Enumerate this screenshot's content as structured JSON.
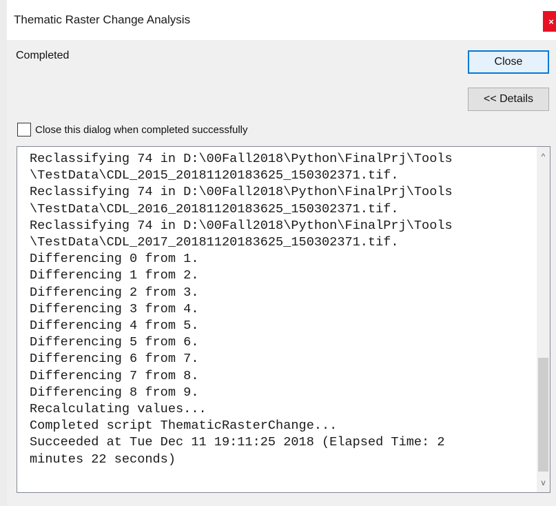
{
  "window": {
    "title": "Thematic Raster Change Analysis",
    "close_glyph": "×"
  },
  "status": {
    "text": "Completed"
  },
  "buttons": {
    "close_label": "Close",
    "details_label": "<< Details"
  },
  "option": {
    "close_when_done_label": "Close this dialog when completed successfully",
    "checked": false
  },
  "output": {
    "lines": [
      "Reclassifying 74 in D:\\00Fall2018\\Python\\FinalPrj\\Tools",
      "\\TestData\\CDL_2015_20181120183625_150302371.tif.",
      "Reclassifying 74 in D:\\00Fall2018\\Python\\FinalPrj\\Tools",
      "\\TestData\\CDL_2016_20181120183625_150302371.tif.",
      "Reclassifying 74 in D:\\00Fall2018\\Python\\FinalPrj\\Tools",
      "\\TestData\\CDL_2017_20181120183625_150302371.tif.",
      "Differencing 0 from 1.",
      "Differencing 1 from 2.",
      "Differencing 2 from 3.",
      "Differencing 3 from 4.",
      "Differencing 4 from 5.",
      "Differencing 5 from 6.",
      "Differencing 6 from 7.",
      "Differencing 7 from 8.",
      "Differencing 8 from 9.",
      "Recalculating values...",
      "Completed script ThematicRasterChange...",
      "Succeeded at Tue Dec 11 19:11:25 2018 (Elapsed Time: 2",
      "minutes 22 seconds)"
    ]
  },
  "scrollbar": {
    "up_glyph": "^",
    "down_glyph": "v"
  },
  "colors": {
    "close_x_bg": "#e81123",
    "default_button_border": "#0078d7"
  }
}
